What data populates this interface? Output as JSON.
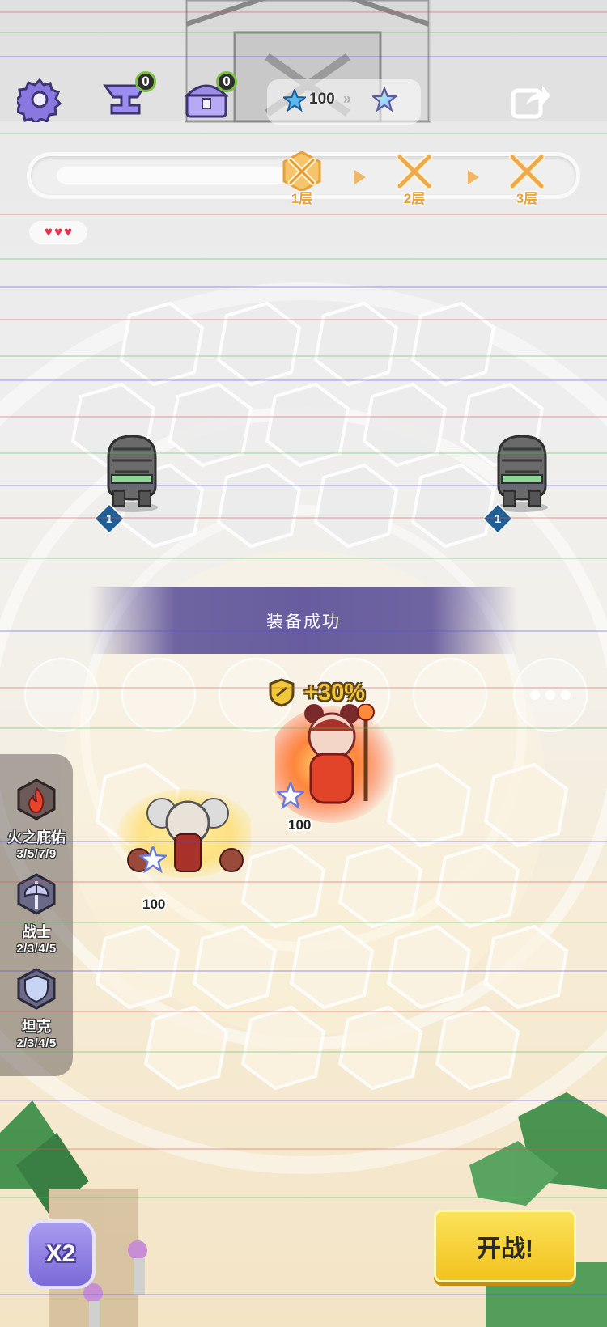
{
  "hud": {
    "anvil_count": "0",
    "chest_count": "0",
    "star_count": "100"
  },
  "floors": [
    {
      "label": "1层",
      "active": true
    },
    {
      "label": "2层",
      "active": false
    },
    {
      "label": "3层",
      "active": false
    }
  ],
  "lives": 3,
  "enemies": [
    {
      "level": "1"
    },
    {
      "level": "1"
    }
  ],
  "banner": {
    "text": "装备成功"
  },
  "buff": {
    "text": "+30%"
  },
  "heroes": [
    {
      "hp": "100"
    },
    {
      "hp": "100"
    }
  ],
  "synergies": [
    {
      "name": "火之庇佑",
      "progress": "3/5/7/9"
    },
    {
      "name": "战士",
      "progress": "2/3/4/5"
    },
    {
      "name": "坦克",
      "progress": "2/3/4/5"
    }
  ],
  "buttons": {
    "speed": "X2",
    "fight": "开战!"
  },
  "colors": {
    "accent_gold": "#f0c83a",
    "floor_label": "#e8a13b",
    "banner": "#584c96",
    "fight_button": "#f2c21e",
    "speed_button": "#7a6ad6"
  }
}
